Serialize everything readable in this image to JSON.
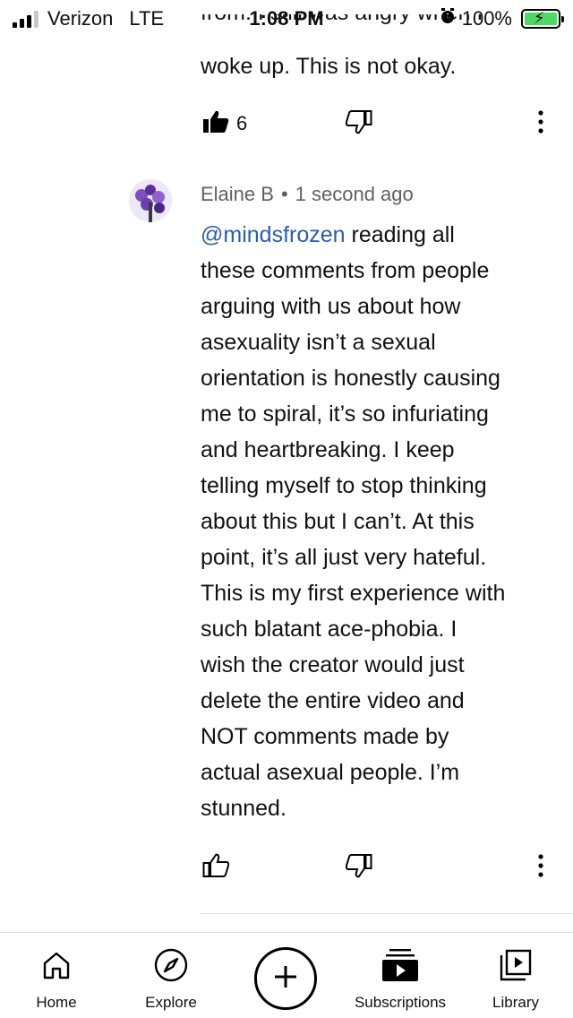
{
  "status_bar": {
    "carrier": "Verizon",
    "network": "LTE",
    "time": "1:08 PM",
    "battery_text": "100%",
    "battery_level": 1.0,
    "signal_bars_active": 3,
    "signal_bars_total": 4
  },
  "previous_comment": {
    "cut_text": "from. I still was angry when I",
    "last_line": "woke up. This is not okay.",
    "like_count": "6"
  },
  "comment": {
    "author": "Elaine B",
    "separator": "•",
    "time": "1 second ago",
    "mention": "@mindsfrozen",
    "lines": [
      " reading all",
      "these comments from people",
      "arguing with us about how",
      "asexuality isn’t a sexual",
      "orientation is honestly causing",
      "me to spiral, it’s so infuriating",
      "and heartbreaking. I keep",
      "telling myself to stop thinking",
      "about this but I can’t. At this",
      "point, it’s all just very hateful.",
      "This is my first experience with",
      "such blatant ace-phobia. I",
      "wish the creator would just",
      "delete the entire video and",
      "NOT comments  made by",
      "actual asexual people. I’m",
      "stunned."
    ]
  },
  "icons": {
    "like_filled": "thumbs-up-filled-icon",
    "like_outline": "thumbs-up-outline-icon",
    "dislike": "thumbs-down-icon",
    "more": "more-vertical-icon"
  },
  "nav": {
    "home": "Home",
    "explore": "Explore",
    "subscriptions": "Subscriptions",
    "library": "Library"
  },
  "colors": {
    "mention": "#2a5db0",
    "meta": "#606060",
    "battery": "#4cd964"
  }
}
